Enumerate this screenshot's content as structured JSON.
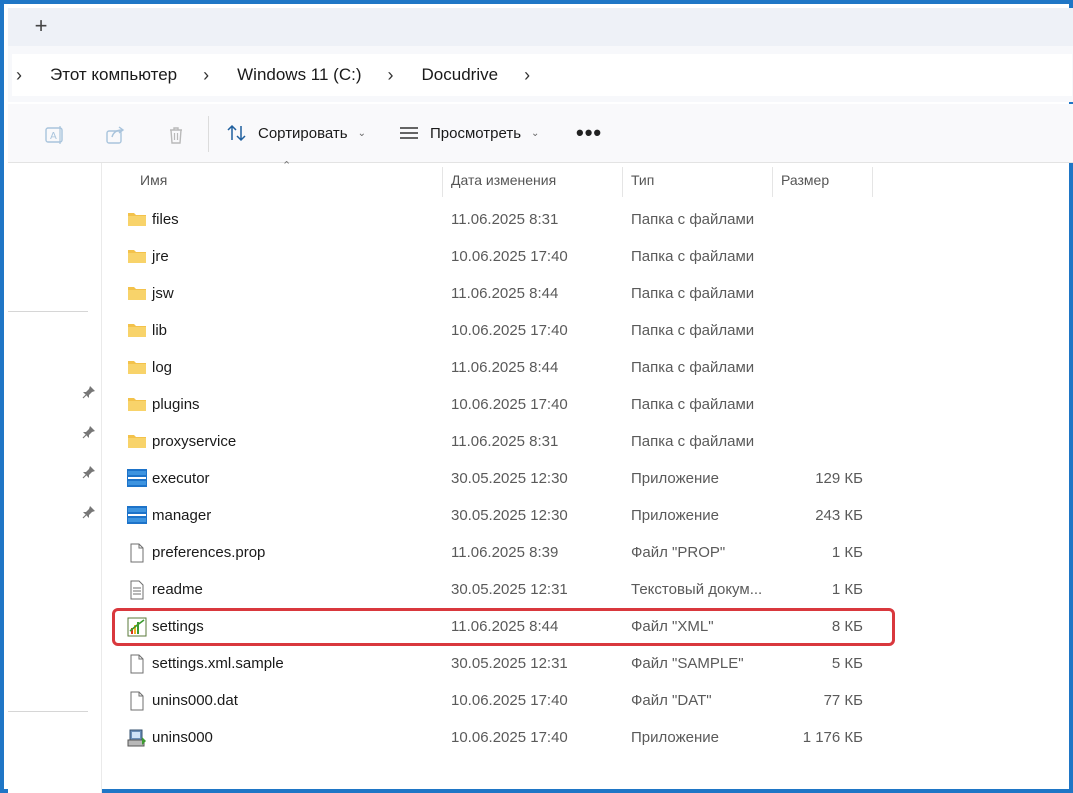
{
  "tabbar": {
    "new_tab_label": "+"
  },
  "breadcrumb": {
    "items": [
      "Этот компьютер",
      "Windows 11 (C:)",
      "Docudrive"
    ]
  },
  "toolbar": {
    "sort_label": "Сортировать",
    "view_label": "Просмотреть",
    "more_label": "•••",
    "icons": [
      "rename-icon",
      "share-icon",
      "delete-icon"
    ]
  },
  "columns": {
    "name": "Имя",
    "date": "Дата изменения",
    "type": "Тип",
    "size": "Размер"
  },
  "files": [
    {
      "name": "files",
      "date": "11.06.2025 8:31",
      "type": "Папка с файлами",
      "size": "",
      "icon": "folder-icon"
    },
    {
      "name": "jre",
      "date": "10.06.2025 17:40",
      "type": "Папка с файлами",
      "size": "",
      "icon": "folder-icon"
    },
    {
      "name": "jsw",
      "date": "11.06.2025 8:44",
      "type": "Папка с файлами",
      "size": "",
      "icon": "folder-icon"
    },
    {
      "name": "lib",
      "date": "10.06.2025 17:40",
      "type": "Папка с файлами",
      "size": "",
      "icon": "folder-icon"
    },
    {
      "name": "log",
      "date": "11.06.2025 8:44",
      "type": "Папка с файлами",
      "size": "",
      "icon": "folder-icon"
    },
    {
      "name": "plugins",
      "date": "10.06.2025 17:40",
      "type": "Папка с файлами",
      "size": "",
      "icon": "folder-icon"
    },
    {
      "name": "proxyservice",
      "date": "11.06.2025 8:31",
      "type": "Папка с файлами",
      "size": "",
      "icon": "folder-icon"
    },
    {
      "name": "executor",
      "date": "30.05.2025 12:30",
      "type": "Приложение",
      "size": "129 КБ",
      "icon": "docudrive-app-icon"
    },
    {
      "name": "manager",
      "date": "30.05.2025 12:30",
      "type": "Приложение",
      "size": "243 КБ",
      "icon": "docudrive-app-icon"
    },
    {
      "name": "preferences.prop",
      "date": "11.06.2025 8:39",
      "type": "Файл \"PROP\"",
      "size": "1 КБ",
      "icon": "file-icon"
    },
    {
      "name": "readme",
      "date": "30.05.2025 12:31",
      "type": "Текстовый докум...",
      "size": "1 КБ",
      "icon": "text-file-icon"
    },
    {
      "name": "settings",
      "date": "11.06.2025 8:44",
      "type": "Файл \"XML\"",
      "size": "8 КБ",
      "icon": "xml-file-icon"
    },
    {
      "name": "settings.xml.sample",
      "date": "30.05.2025 12:31",
      "type": "Файл \"SAMPLE\"",
      "size": "5 КБ",
      "icon": "file-icon"
    },
    {
      "name": "unins000.dat",
      "date": "10.06.2025 17:40",
      "type": "Файл \"DAT\"",
      "size": "77 КБ",
      "icon": "file-icon"
    },
    {
      "name": "unins000",
      "date": "10.06.2025 17:40",
      "type": "Приложение",
      "size": "1 176 КБ",
      "icon": "installer-icon"
    }
  ],
  "highlighted_file": "settings",
  "colors": {
    "frame_border": "#1f76c6",
    "highlight_border": "#d9383d",
    "folder": "#f3c24b"
  }
}
